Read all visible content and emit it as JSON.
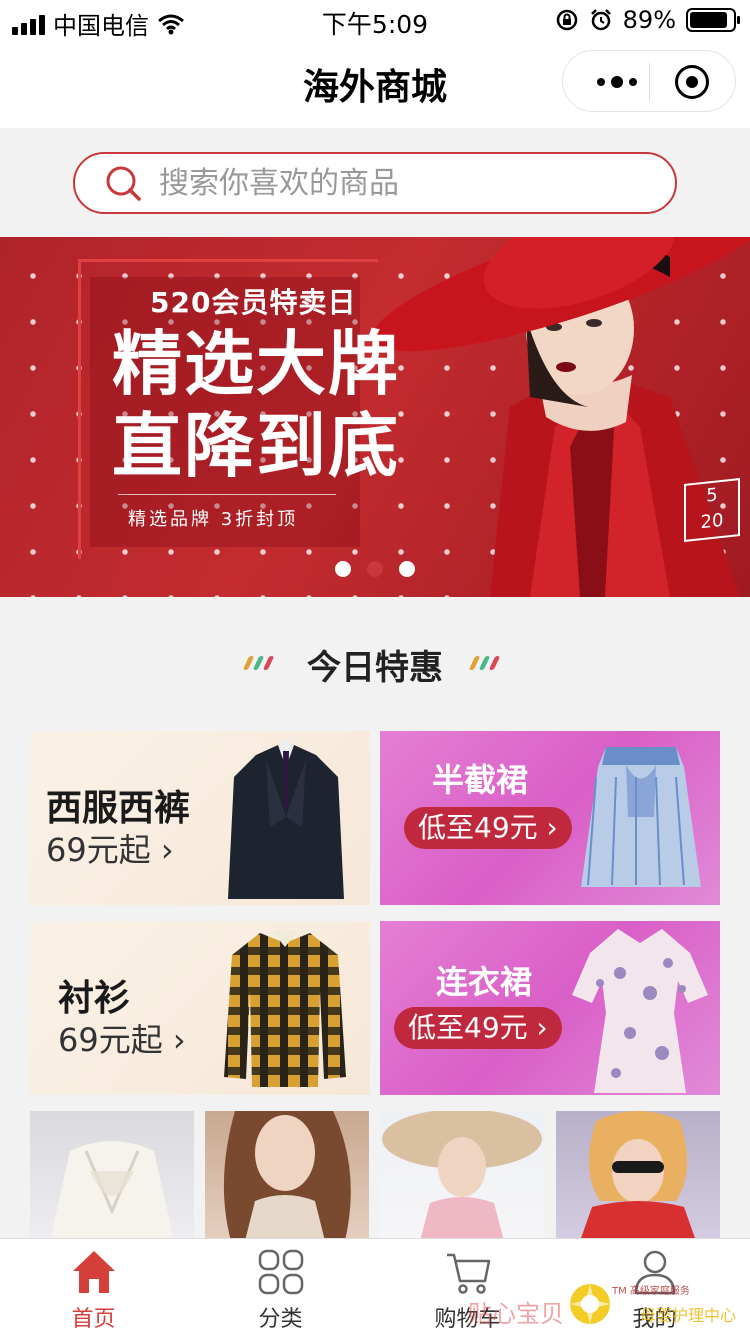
{
  "status_bar": {
    "carrier": "中国电信",
    "time": "下午5:09",
    "battery_text": "89%",
    "battery_level": 0.89
  },
  "nav": {
    "title": "海外商城"
  },
  "search": {
    "placeholder": "搜索你喜欢的商品"
  },
  "banner": {
    "subtitle": "520会员特卖日",
    "headline_line1": "精选大牌",
    "headline_line2": "直降到底",
    "tagline": "精选品牌  3折封顶",
    "badge_top": "5",
    "badge_bottom": "20",
    "pager_count": 3,
    "pager_active_index": 1
  },
  "section": {
    "title": "今日特惠"
  },
  "promos": [
    {
      "label": "西服西裤",
      "price": "69元起 ›"
    },
    {
      "label": "半截裙",
      "price": "低至49元 ›"
    },
    {
      "label": "衬衫",
      "price": "69元起 ›"
    },
    {
      "label": "连衣裙",
      "price": "低至49元 ›"
    }
  ],
  "tabbar": {
    "items": [
      {
        "label": "首页",
        "icon": "home-icon",
        "active": true
      },
      {
        "label": "分类",
        "icon": "category-icon",
        "active": false
      },
      {
        "label": "购物车",
        "icon": "cart-icon",
        "active": false
      },
      {
        "label": "我的",
        "icon": "user-icon",
        "active": false
      }
    ]
  },
  "watermark": {
    "text1": "贴心宝贝",
    "text2": "TM 高级家庭服务",
    "text3": "母婴护理中心"
  },
  "colors": {
    "accent": "#c9383a",
    "tab_active": "#d43f3a",
    "promo_pink": "#d95fc7",
    "pill": "#c0283d"
  }
}
